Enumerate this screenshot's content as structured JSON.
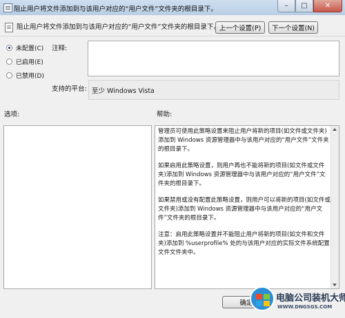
{
  "window": {
    "title": "阻止用户将文件添加到与该用户对应的“用户文件”文件夹的根目录下。",
    "controls": {
      "minimize": "–",
      "maximize": "□",
      "close": "✕"
    }
  },
  "policy": {
    "header": "阻止用户将文件添加到与该用户对应的“用户文件”文件夹的根目录下。",
    "prev_button": "上一个设置(P)",
    "next_button": "下一个设置(N)"
  },
  "state": {
    "options": [
      {
        "label": "未配置(C)",
        "selected": true
      },
      {
        "label": "已启用(E)",
        "selected": false
      },
      {
        "label": "已禁用(D)",
        "selected": false
      }
    ]
  },
  "comment": {
    "label": "注释:",
    "value": ""
  },
  "platform": {
    "label": "支持的平台:",
    "value": "至少 Windows Vista"
  },
  "options_section": {
    "label": "选项:"
  },
  "help_section": {
    "label": "帮助:",
    "paragraphs": [
      "管理员可使用此策略设置来阻止用户将新的项目(如文件或文件夹)添加到 Windows 资源管理器中与该用户对应的“用户文件”文件夹的根目录下。",
      "如果启用此策略设置，则用户再也不能将新的项目(如文件或文件夹)添加到 Windows 资源管理器中与该用户对应的“用户文件”文件夹的根目录下。",
      "如果禁用或没有配置此策略设置，则用户可以将新的项目(如文件或文件夹)添加到 Windows 资源管理器中与该用户对应的“用户文件”文件夹的根目录下。",
      "注意：启用此策略设置并不能阻止用户将新的项目(如文件和文件夹)添加到 %userprofile% 处的与该用户对应的实际文件系统配置文件文件夹中。"
    ]
  },
  "footer": {
    "ok_button": "确定"
  },
  "watermark": {
    "line1": "电脑公司装机大师",
    "line2": "WWW.DNGSGS.COM"
  }
}
